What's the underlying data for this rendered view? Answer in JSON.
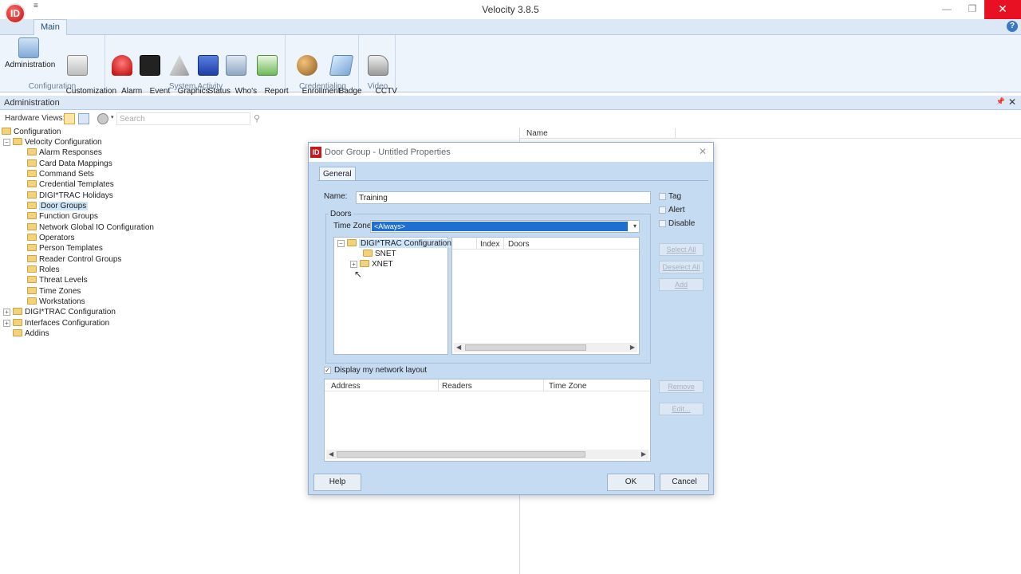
{
  "window": {
    "title": "Velocity 3.8.5",
    "logo_text": "ID",
    "qat": "≡",
    "minimize": "—",
    "restore": "❐",
    "close": "✕"
  },
  "ribbon": {
    "tab": "Main",
    "help": "?",
    "groups": [
      {
        "label": "Configuration",
        "buttons": [
          "Administration",
          "Customization\nManager"
        ]
      },
      {
        "label": "System Activity",
        "buttons": [
          "Alarm\nViewer",
          "Event\nViewer",
          "Graphics",
          "Status\nViewer",
          "Who's\nInside",
          "Report\nManager"
        ]
      },
      {
        "label": "Credentialing",
        "buttons": [
          "Enrollment\nManager",
          "Badge\nDesigner"
        ]
      },
      {
        "label": "Video",
        "buttons": [
          "CCTV\nViewer"
        ]
      }
    ]
  },
  "panel": {
    "title": "Administration",
    "pin": "📌",
    "close": "✕"
  },
  "toolbar": {
    "label": "Hardware Views:",
    "search_placeholder": "Search"
  },
  "tree": {
    "root": "Configuration",
    "velocity": "Velocity Configuration",
    "items": [
      "Alarm Responses",
      "Card Data Mappings",
      "Command Sets",
      "Credential Templates",
      "DIGI*TRAC Holidays",
      "Door Groups",
      "Function Groups",
      "Network Global IO Configuration",
      "Operators",
      "Person Templates",
      "Reader Control Groups",
      "Roles",
      "Threat Levels",
      "Time Zones",
      "Workstations"
    ],
    "digitrac": "DIGI*TRAC Configuration",
    "interfaces": "Interfaces Configuration",
    "addins": "Addins"
  },
  "list": {
    "column": "Name"
  },
  "dialog": {
    "title": "Door Group - Untitled Properties",
    "logo": "ID",
    "close": "✕",
    "tab": "General",
    "name_label": "Name:",
    "name_value": "Training",
    "tag": "Tag",
    "alert": "Alert",
    "disable": "Disable",
    "doors_label": "Doors",
    "timezone_label": "Time Zone:",
    "timezone_value": "<Always>",
    "tree_root": "DIGI*TRAC Configuration",
    "tree_snet": "SNET",
    "tree_xnet": "XNET",
    "doors_cols": [
      "Index",
      "Doors"
    ],
    "select_all": "Select All",
    "deselect_all": "Deselect All",
    "add": "Add",
    "display_layout": "Display my network layout",
    "bottom_cols": [
      "Address",
      "Readers",
      "Time Zone"
    ],
    "remove": "Remove",
    "edit": "Edit...",
    "help": "Help",
    "ok": "OK",
    "cancel": "Cancel"
  }
}
